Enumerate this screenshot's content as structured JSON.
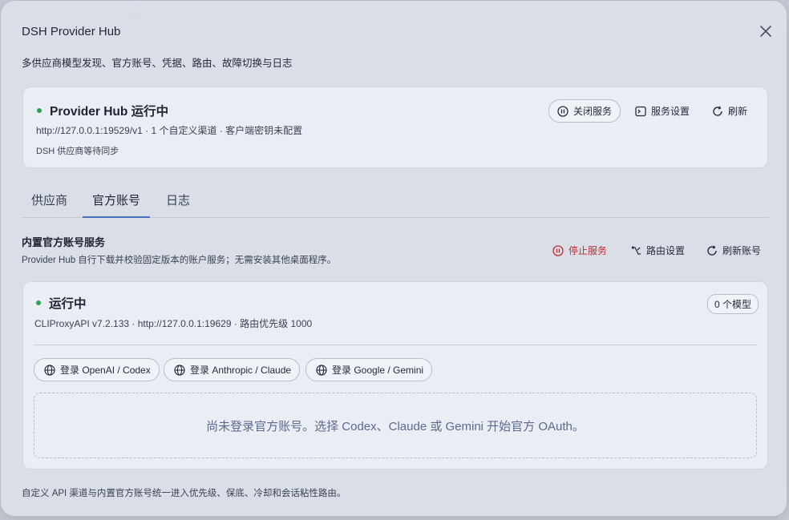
{
  "dialog": {
    "title": "DSH Provider Hub",
    "subtitle": "多供应商模型发现、官方账号、凭据、路由、故障切换与日志"
  },
  "hub": {
    "status": "Provider Hub 运行中",
    "url_line": "http://127.0.0.1:19529/v1 · 1 个自定义渠道 · 客户端密钥未配置",
    "sync_line": "DSH 供应商等待同步",
    "stop_label": "关闭服务",
    "settings_label": "服务设置",
    "refresh_label": "刷新"
  },
  "tabs": [
    {
      "label": "供应商",
      "active": false
    },
    {
      "label": "官方账号",
      "active": true
    },
    {
      "label": "日志",
      "active": false
    }
  ],
  "section": {
    "title": "内置官方账号服务",
    "desc": "Provider Hub 自行下载并校验固定版本的账户服务；无需安装其他桌面程序。",
    "stop_label": "停止服务",
    "route_label": "路由设置",
    "refresh_label": "刷新账号"
  },
  "service": {
    "status": "运行中",
    "detail": "CLIProxyAPI v7.2.133 · http://127.0.0.1:19629 · 路由优先级 1000",
    "model_badge": "0 个模型",
    "login_buttons": [
      "登录 OpenAI / Codex",
      "登录 Anthropic / Claude",
      "登录 Google / Gemini"
    ],
    "empty_text": "尚未登录官方账号。选择 Codex、Claude 或 Gemini 开始官方 OAuth。"
  },
  "footer": "自定义 API 渠道与内置官方账号统一进入优先级、保底、冷却和会话粘性路由。",
  "colors": {
    "status_green": "#2ea25a",
    "stop_red": "#c42b2b",
    "tab_accent": "#4a6fbf"
  },
  "icons": {
    "close": "close-icon",
    "pause": "pause-circle-icon",
    "terminal": "terminal-icon",
    "refresh": "refresh-icon",
    "route": "route-icon",
    "globe": "globe-icon"
  }
}
